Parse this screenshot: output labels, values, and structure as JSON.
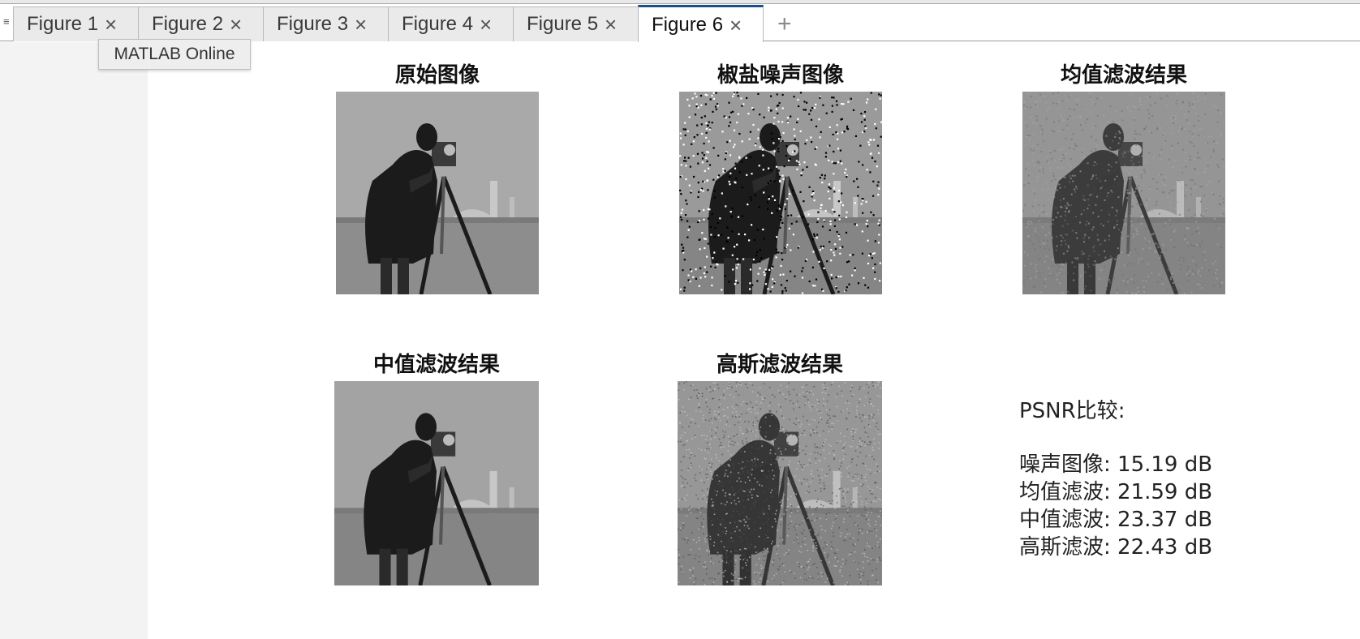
{
  "tabs": [
    {
      "label": "Figure 1",
      "active": false
    },
    {
      "label": "Figure 2",
      "active": false
    },
    {
      "label": "Figure 3",
      "active": false
    },
    {
      "label": "Figure 4",
      "active": false
    },
    {
      "label": "Figure 5",
      "active": false
    },
    {
      "label": "Figure 6",
      "active": true
    }
  ],
  "tooltip": "MATLAB Online",
  "subplots": [
    {
      "title": "原始图像",
      "variant": "original"
    },
    {
      "title": "椒盐噪声图像",
      "variant": "saltpepper"
    },
    {
      "title": "均值滤波结果",
      "variant": "mean"
    },
    {
      "title": "中值滤波结果",
      "variant": "median"
    },
    {
      "title": "高斯滤波结果",
      "variant": "gaussian"
    }
  ],
  "psnr": {
    "heading": "PSNR比较:",
    "lines": [
      "噪声图像: 15.19 dB",
      "均值滤波: 21.59 dB",
      "中值滤波: 23.37 dB",
      "高斯滤波: 22.43 dB"
    ]
  },
  "icons": {
    "close": "close-icon",
    "add": "plus-icon",
    "grip": "grip-icon"
  }
}
